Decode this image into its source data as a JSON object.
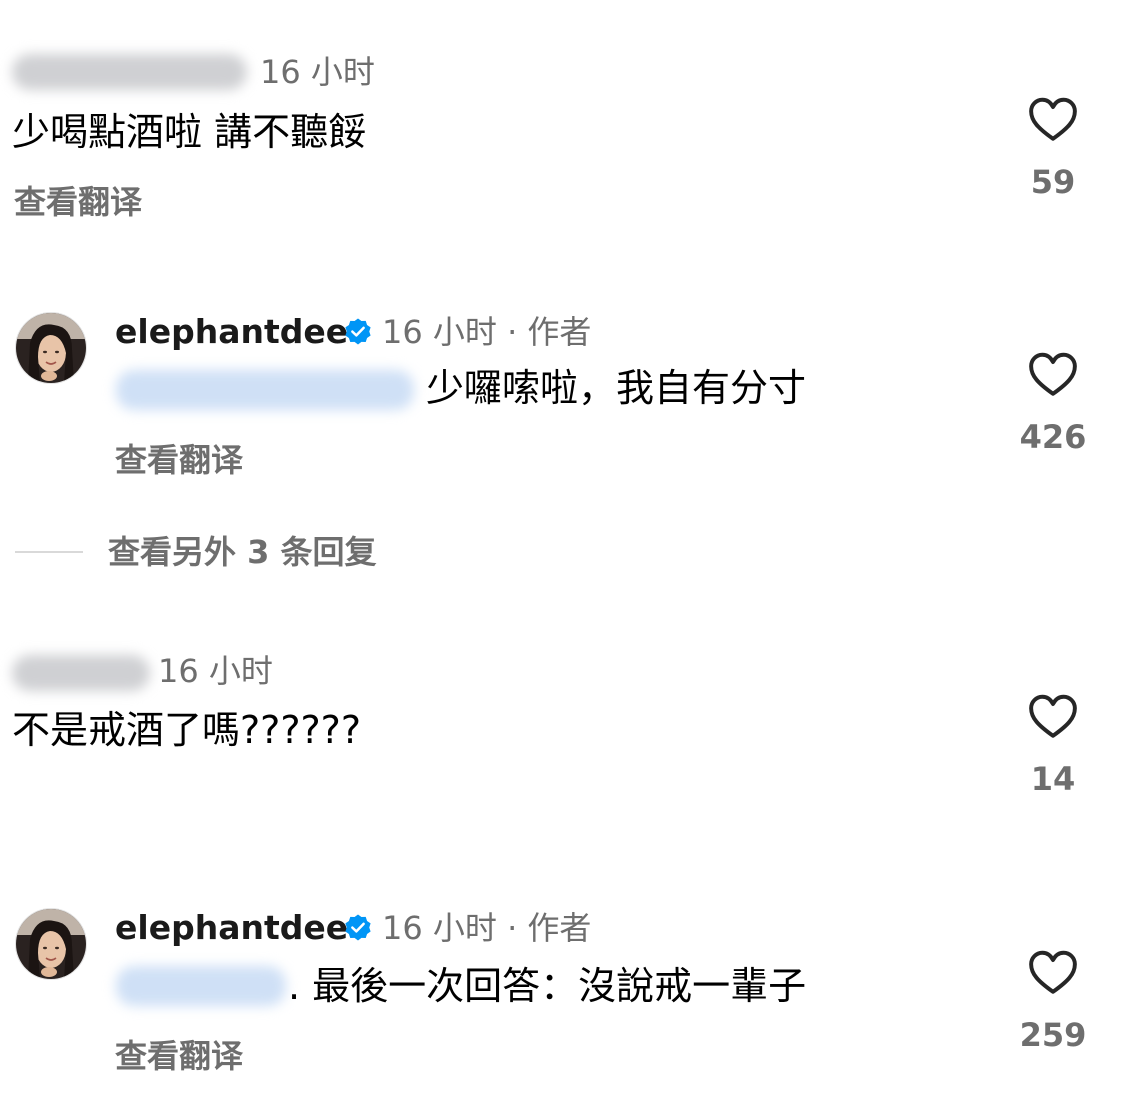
{
  "comments": [
    {
      "time": "16 小时",
      "text": "少喝點酒啦 講不聽餒",
      "translate": "查看翻译",
      "likes": "59"
    },
    {
      "username": "elephantdee",
      "verified": true,
      "time": "16 小时 · 作者",
      "text": "少囉嗦啦，我自有分寸",
      "translate": "查看翻译",
      "likes": "426"
    },
    {
      "time": "16 小时",
      "text": "不是戒酒了嗎??????",
      "likes": "14"
    },
    {
      "username": "elephantdee",
      "verified": true,
      "time": "16 小时 · 作者",
      "text": ". 最後一次回答：沒說戒一輩子",
      "translate": "查看翻译",
      "likes": "259"
    }
  ],
  "view_more_replies": "查看另外 3 条回复",
  "icons": {
    "like": "heart-outline-icon",
    "verified": "verified-badge-icon"
  },
  "colors": {
    "verified": "#0095f6",
    "secondary_text": "#6e6e6e",
    "like_stroke": "#262626"
  }
}
